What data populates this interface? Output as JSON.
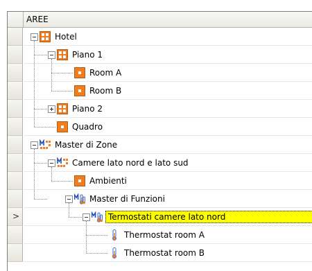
{
  "column_header": "AREE",
  "current_row_marker": ">",
  "colors": {
    "selection_highlight": "#ffff00",
    "area_icon_orange": "#f07d20",
    "master_zone_blue": "#1f4fb8",
    "thermometer_blue": "#3a6fd0"
  },
  "tree": [
    {
      "label": "Hotel",
      "icon": "area-group-icon",
      "expander": "minus"
    },
    {
      "label": "Piano 1",
      "icon": "area-group-icon",
      "expander": "minus"
    },
    {
      "label": "Room A",
      "icon": "area-icon",
      "expander": "none"
    },
    {
      "label": "Room B",
      "icon": "area-icon",
      "expander": "none"
    },
    {
      "label": "Piano 2",
      "icon": "area-group-icon",
      "expander": "plus"
    },
    {
      "label": "Quadro",
      "icon": "area-icon",
      "expander": "none"
    },
    {
      "label": "Master di Zone",
      "icon": "master-zone-icon",
      "expander": "minus"
    },
    {
      "label": "Camere lato nord e lato sud",
      "icon": "master-zone-icon",
      "expander": "minus"
    },
    {
      "label": "Ambienti",
      "icon": "area-icon",
      "expander": "none"
    },
    {
      "label": "Master di Funzioni",
      "icon": "master-function-icon",
      "expander": "minus"
    },
    {
      "label": "Termostati camere lato nord",
      "icon": "master-function-icon",
      "expander": "minus",
      "selected": true
    },
    {
      "label": "Thermostat room A",
      "icon": "thermometer-icon",
      "expander": "none"
    },
    {
      "label": "Thermostat room B",
      "icon": "thermometer-icon",
      "expander": "none"
    }
  ]
}
